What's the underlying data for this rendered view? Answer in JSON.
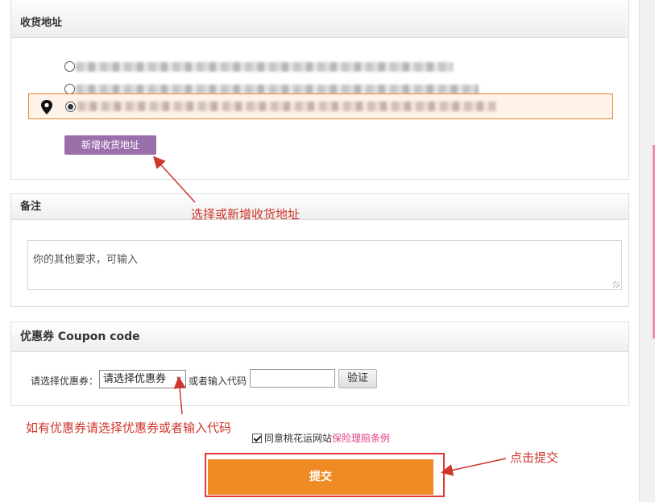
{
  "address": {
    "title": "收货地址",
    "add_button": "新增收货地址"
  },
  "remark": {
    "title": "备注",
    "placeholder": "你的其他要求，可输入"
  },
  "coupon": {
    "title": "优惠券 Coupon code",
    "label": "请选择优惠券：",
    "select_value": "请选择优惠券",
    "or_text": "或者输入代码",
    "verify_button": "验证"
  },
  "agreement": {
    "text": "同意桃花运网站",
    "link": "保险理赔条例",
    "checked": true
  },
  "submit_label": "提交",
  "annotations": {
    "address": "选择或新增收货地址",
    "coupon": "如有优惠券请选择优惠券或者输入代码",
    "submit": "点击提交"
  },
  "colors": {
    "accent": "#f08a25",
    "annotation": "#d0362c",
    "add_button": "#9a6fab",
    "link": "#e0408a"
  }
}
